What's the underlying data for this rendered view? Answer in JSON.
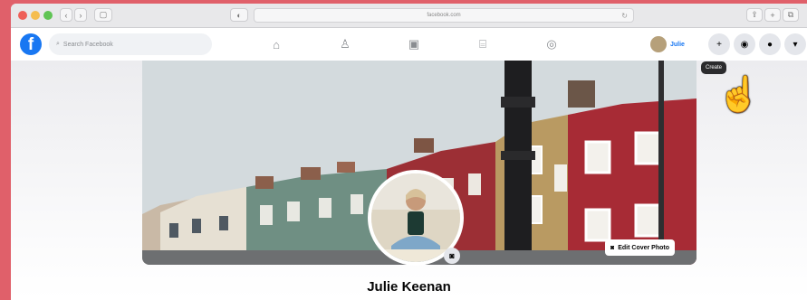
{
  "browser": {
    "url": "facebook.com",
    "reload_icon": "reload-icon",
    "buttons": [
      "back-icon",
      "forward-icon",
      "sidebar-icon",
      "share-icon",
      "tabs-icon",
      "new-tab-icon",
      "extension-icon"
    ]
  },
  "fb_nav": {
    "logo": "f",
    "search_placeholder": "Search Facebook",
    "nav_icons": [
      "home-icon",
      "friends-icon",
      "watch-icon",
      "marketplace-icon",
      "groups-icon"
    ],
    "profile_name": "Julie",
    "actions": [
      "+",
      "◉",
      "●",
      "▾"
    ]
  },
  "tooltip": {
    "text": "Create"
  },
  "profile": {
    "edit_cover_label": "Edit Cover Photo",
    "name": "Julie Keenan"
  },
  "colors": {
    "brand": "#1877f2",
    "background_frame": "#e0606a"
  }
}
